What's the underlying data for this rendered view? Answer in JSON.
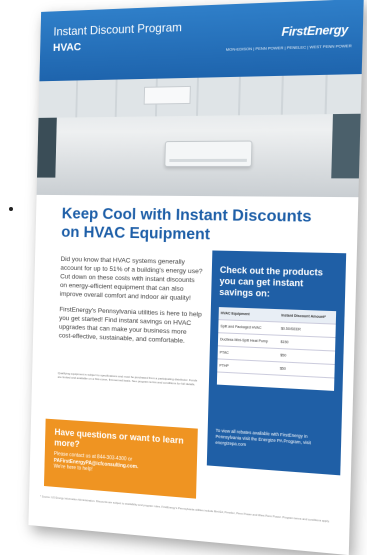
{
  "header": {
    "program": "Instant Discount Program",
    "category": "HVAC",
    "logo": "FirstEnergy",
    "tagline": "MON-EDISON | PENN POWER | PENELEC | WEST PENN POWER"
  },
  "headline": "Keep Cool with Instant Discounts on HVAC Equipment",
  "body": {
    "p1": "Did you know that HVAC systems generally account for up to 51% of a building's energy use? Cut down on these costs with instant discounts on energy-efficient equipment that can also improve overall comfort and indoor air quality!",
    "p2": "FirstEnergy's Pennsylvania utilities is here to help you get started! Find instant savings on HVAC upgrades that can make your business more cost-effective, sustainable, and comfortable."
  },
  "fine_print": "Qualifying equipment is subject to specifications and must be purchased from a participating distributor. Funds are limited and available on a first-come, first-served basis. See program terms and conditions for full details.",
  "side_panel": {
    "title": "Check out the products you can get instant savings on:",
    "table_headers": [
      "HVAC Equipment",
      "Instant Discount Amount*"
    ],
    "rows": [
      [
        "Split and Packaged HVAC",
        "$0.50/SEER"
      ],
      [
        "Ductless Mini-Split Heat Pump",
        "$150"
      ],
      [
        "PTAC",
        "$50"
      ],
      [
        "PTHP",
        "$50"
      ],
      [
        "",
        ""
      ]
    ],
    "note": "To view all rebates available with FirstEnergy in Pennsylvania visit the Energize PA Program, visit energizepa.com"
  },
  "contact": {
    "question": "Have questions or want to learn more?",
    "line1": "Please contact us at 844-303-4300 or",
    "line2": "PAFirstEnergyPA@icfconsulting.com.",
    "line3": "We're here to help!"
  },
  "footer": "* Source: US Energy Information Administration. Discounts are subject to availability and program rules. FirstEnergy's Pennsylvania utilities include Met-Ed, Penelec, Penn Power and West Penn Power. Program terms and conditions apply."
}
